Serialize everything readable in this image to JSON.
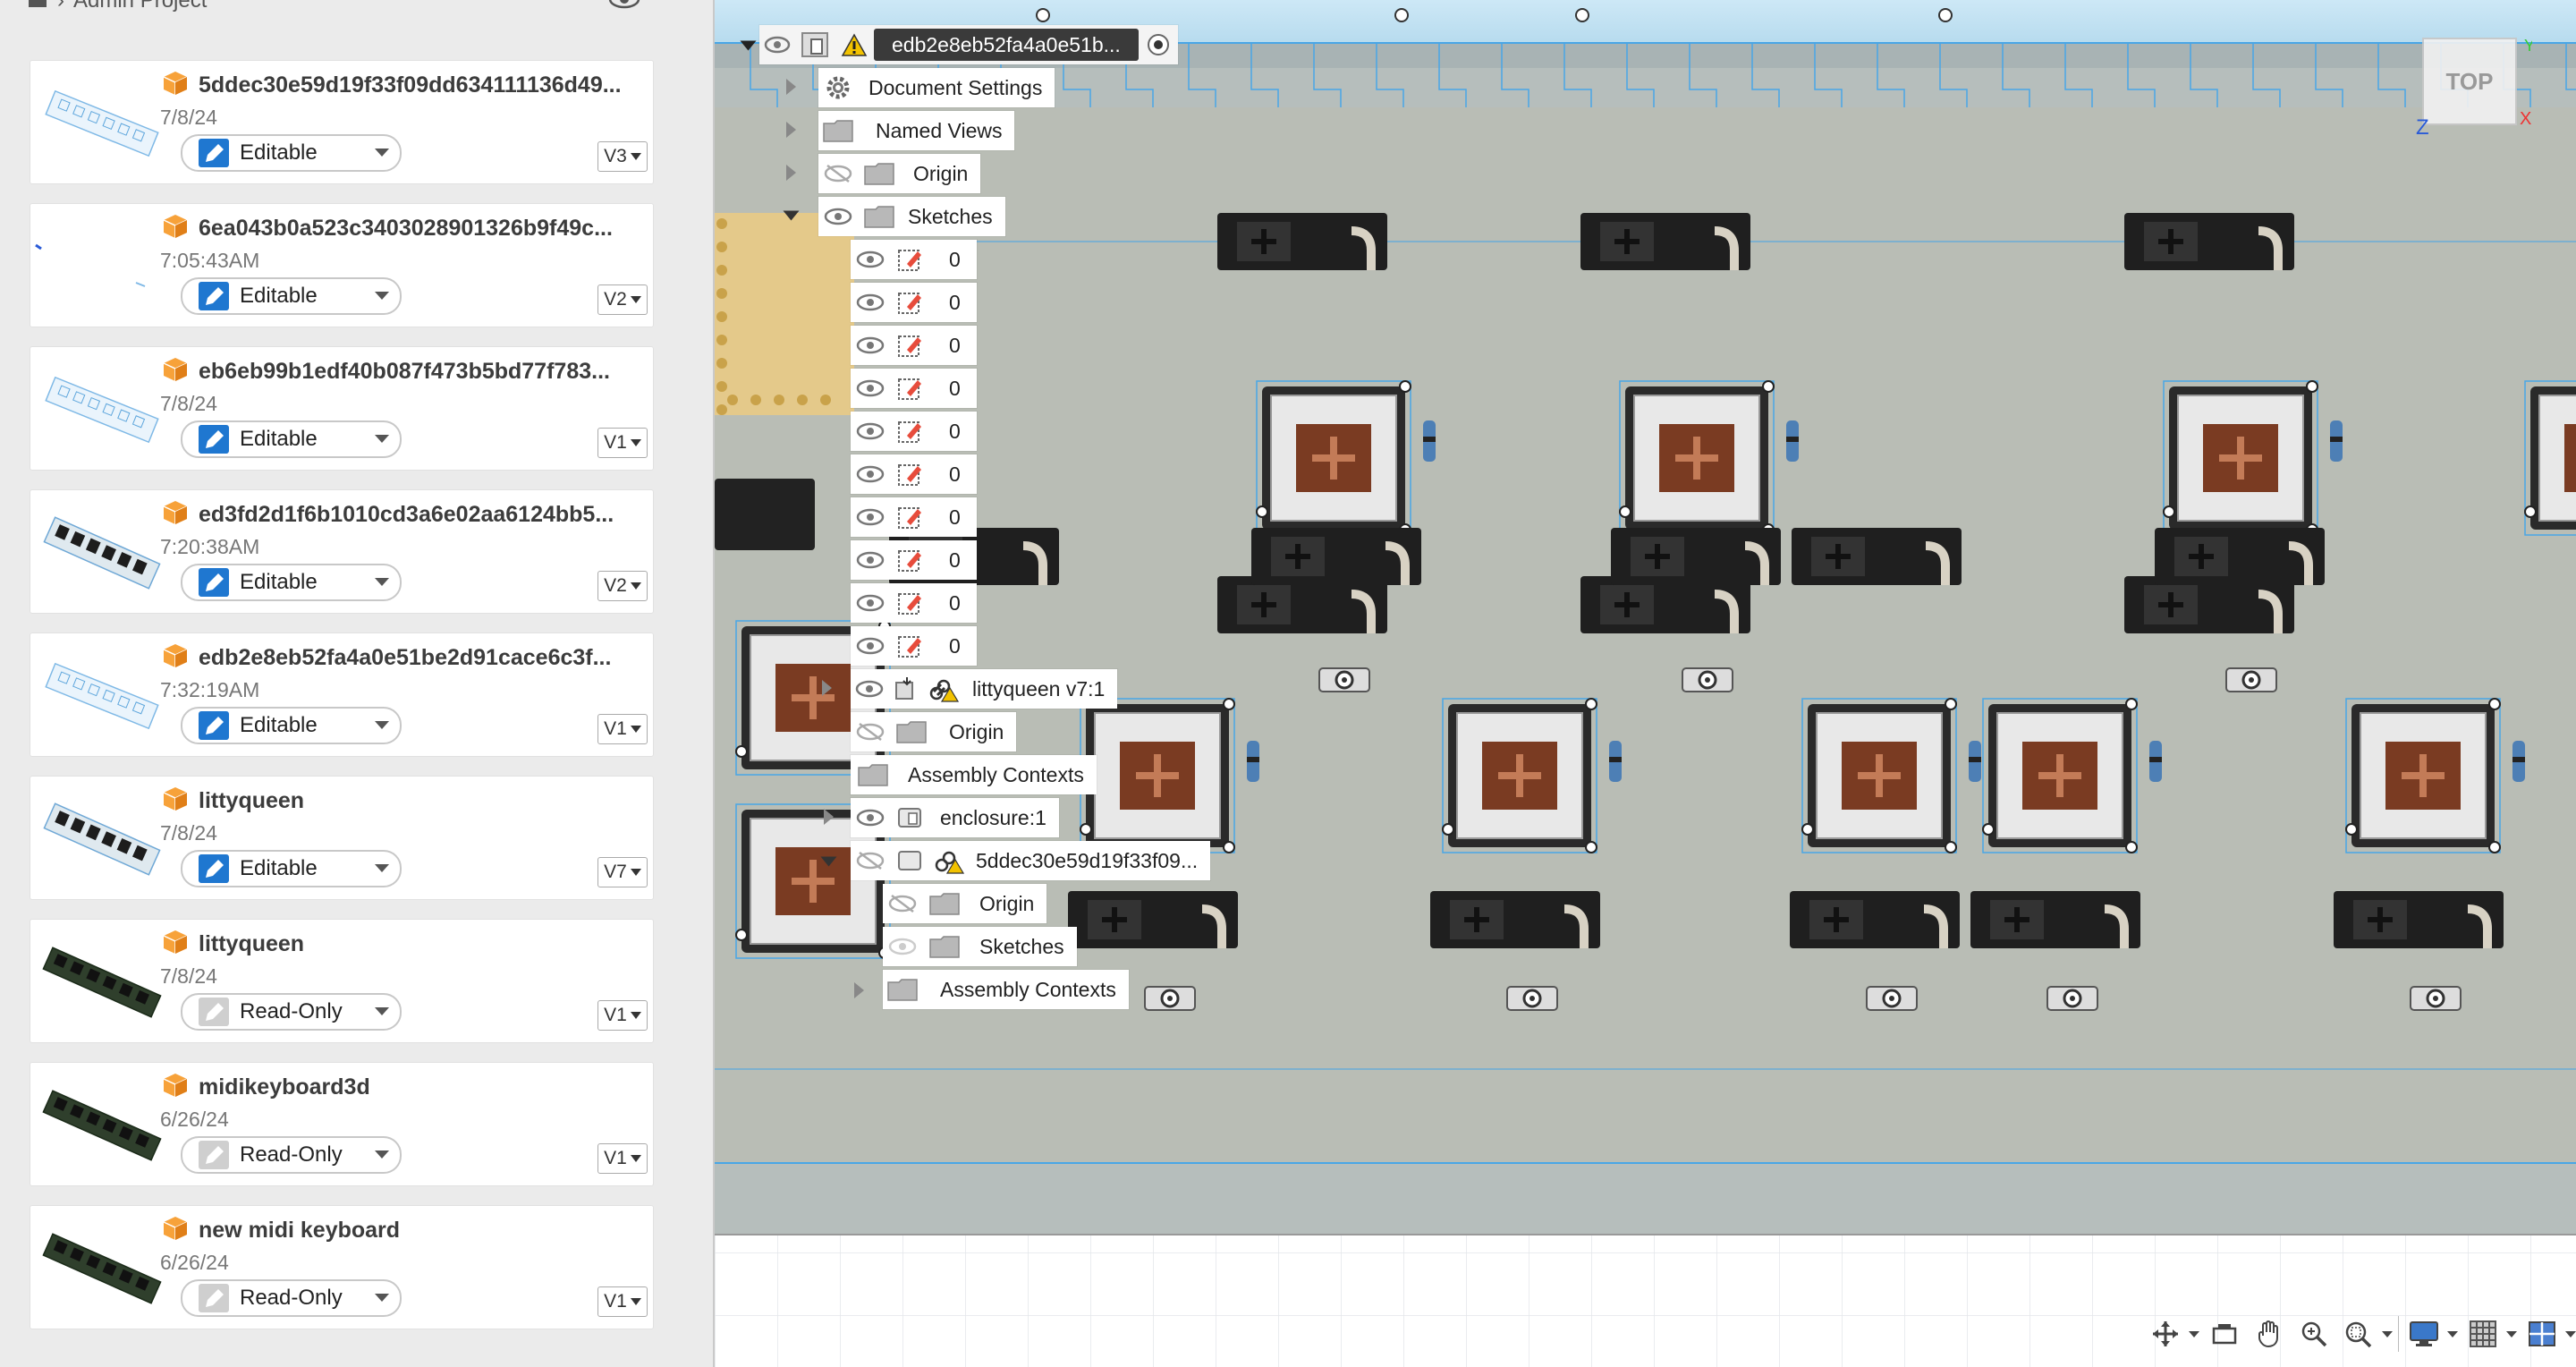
{
  "breadcrumb": {
    "project": "Admin Project"
  },
  "files": [
    {
      "name": "5ddec30e59d19f33f09dd634111136d49...",
      "date": "7/8/24",
      "permission": "Editable",
      "version": "V3",
      "thumb": "light"
    },
    {
      "name": "6ea043b0a523c3403028901326b9f49c...",
      "date": "7:05:43AM",
      "permission": "Editable",
      "version": "V2",
      "thumb": "blank"
    },
    {
      "name": "eb6eb99b1edf40b087f473b5bd77f783...",
      "date": "7/8/24",
      "permission": "Editable",
      "version": "V1",
      "thumb": "light"
    },
    {
      "name": "ed3fd2d1f6b1010cd3a6e02aa6124bb5...",
      "date": "7:20:38AM",
      "permission": "Editable",
      "version": "V2",
      "thumb": "dark"
    },
    {
      "name": "edb2e8eb52fa4a0e51be2d91cace6c3f...",
      "date": "7:32:19AM",
      "permission": "Editable",
      "version": "V1",
      "thumb": "light"
    },
    {
      "name": "littyqueen",
      "date": "7/8/24",
      "permission": "Editable",
      "version": "V7",
      "thumb": "dark"
    },
    {
      "name": "littyqueen",
      "date": "7/8/24",
      "permission": "Read-Only",
      "version": "V1",
      "thumb": "green"
    },
    {
      "name": "midikeyboard3d",
      "date": "6/26/24",
      "permission": "Read-Only",
      "version": "V1",
      "thumb": "green"
    },
    {
      "name": "new midi keyboard",
      "date": "6/26/24",
      "permission": "Read-Only",
      "version": "V1",
      "thumb": "green"
    }
  ],
  "browser": {
    "root": "edb2e8eb52fa4a0e51b...",
    "document_settings": "Document Settings",
    "named_views": "Named Views",
    "origin": "Origin",
    "sketches": "Sketches",
    "sketch_items": [
      "0",
      "0",
      "0",
      "0",
      "0",
      "0",
      "0",
      "0",
      "0",
      "0"
    ],
    "component": "littyqueen v7:1",
    "comp_origin": "Origin",
    "comp_assembly_contexts": "Assembly Contexts",
    "enclosure": "enclosure:1",
    "sub_component": "5ddec30e59d19f33f09...",
    "sub_origin": "Origin",
    "sub_sketches": "Sketches",
    "sub_assembly_contexts": "Assembly Contexts"
  },
  "viewcube": {
    "face": "TOP",
    "axis_x": "X",
    "axis_y": "Y",
    "axis_z": "Z"
  },
  "colors": {
    "accent": "#1f77d0",
    "selected": "#3a3a3a",
    "warning": "#f2c200",
    "fusion_orange": "#f28c28",
    "pcb": "#a9b3b5",
    "sketch_line": "#49a6e6"
  }
}
